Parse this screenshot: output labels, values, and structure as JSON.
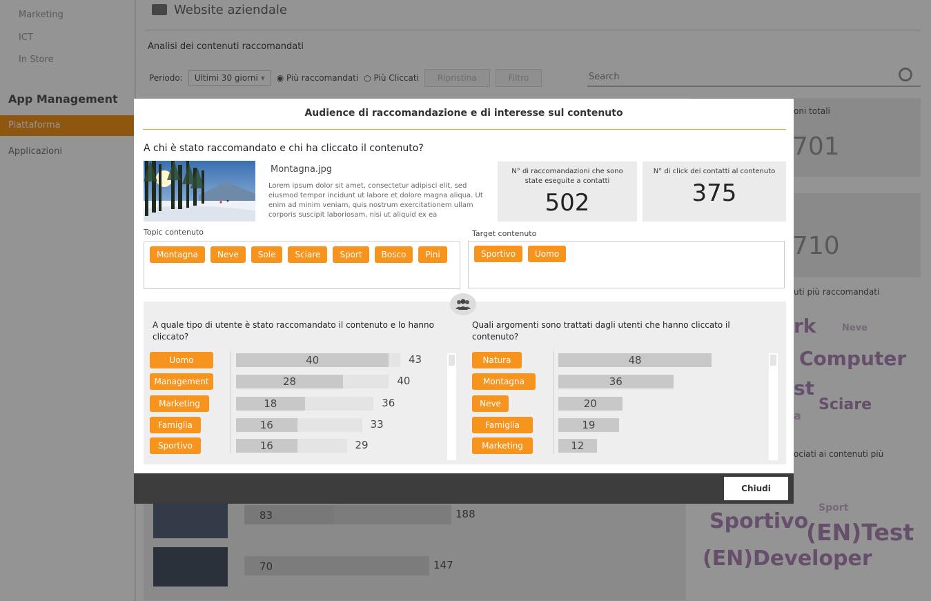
{
  "sidebar": {
    "items_top": [
      "Marketing",
      "ICT",
      "In Store"
    ],
    "section": "App Management",
    "selected": "Piattaforma",
    "item_after": "Applicazioni"
  },
  "background": {
    "title": "Website aziendale",
    "subtitle": "Analisi dei contenuti raccomandati",
    "period_label": "Periodo:",
    "period_value": "Ultimi 30 giorni",
    "radio_1": "Più raccomandati",
    "radio_2": "Più Cliccati",
    "reset_label": "Ripristina",
    "filter_label": "Filtro",
    "search_placeholder": "Search",
    "panel_1_label": "oni totali",
    "panel_1_value": "701",
    "panel_2_value": "710",
    "panel_3_label": "uti più raccomandati",
    "panel_4_label": "ociati ai contenuti più",
    "wordcloud": [
      "rk",
      "Neve",
      "Computer",
      "st",
      "Sciare",
      "a",
      "Sport",
      "Sportivo",
      "(EN)Test",
      "(EN)Developer"
    ],
    "list_values": [
      {
        "inner": "83",
        "outer": "188"
      },
      {
        "inner": "70",
        "outer": "147"
      }
    ]
  },
  "modal": {
    "title": "Audience di raccomandazione e di interesse sul contenuto",
    "question": "A chi è stato raccomandato e chi ha cliccato il contenuto?",
    "image_name": "Montagna.jpg",
    "image_desc": "Lorem ipsum dolor sit amet, consectetur adipisci elit, sed eiusmod tempor incidunt ut labore et dolore magna aliqua. Ut enim ad minim veniam, quis nostrum exercitationem ullam corporis suscipit laboriosam, nisi ut aliquid ex ea",
    "stat_reco_label": "N° di raccomandazioni che sono state eseguite a contatti",
    "stat_reco_value": "502",
    "stat_click_label": "N° di click dei contatti al contenuto",
    "stat_click_value": "375",
    "topic_label": "Topic contenuto",
    "topics": [
      "Montagna",
      "Neve",
      "Sole",
      "Sciare",
      "Sport",
      "Bosco",
      "Pini"
    ],
    "target_label": "Target contenuto",
    "targets": [
      "Sportivo",
      "Uomo"
    ],
    "users_question": "A quale tipo di utente è stato raccomandato il contenuto e lo hanno cliccato?",
    "users": [
      {
        "label": "Uomo",
        "inner": 40,
        "total": 43
      },
      {
        "label": "Management",
        "inner": 28,
        "total": 40
      },
      {
        "label": "Marketing",
        "inner": 18,
        "total": 36
      },
      {
        "label": "Famiglia",
        "inner": 16,
        "total": 33
      },
      {
        "label": "Sportivo",
        "inner": 16,
        "total": 29
      }
    ],
    "args_question": "Quali argomenti sono trattati dagli utenti che hanno cliccato il contenuto?",
    "args": [
      {
        "label": "Natura",
        "value": 48
      },
      {
        "label": "Montagna",
        "value": 36
      },
      {
        "label": "Neve",
        "value": 20
      },
      {
        "label": "Famiglia",
        "value": 19
      },
      {
        "label": "Marketing",
        "value": 12
      }
    ],
    "close_label": "Chiudi"
  },
  "colors": {
    "accent": "#f7941d",
    "footer": "#3c3c3c",
    "wordcloud": "#b088b8"
  }
}
